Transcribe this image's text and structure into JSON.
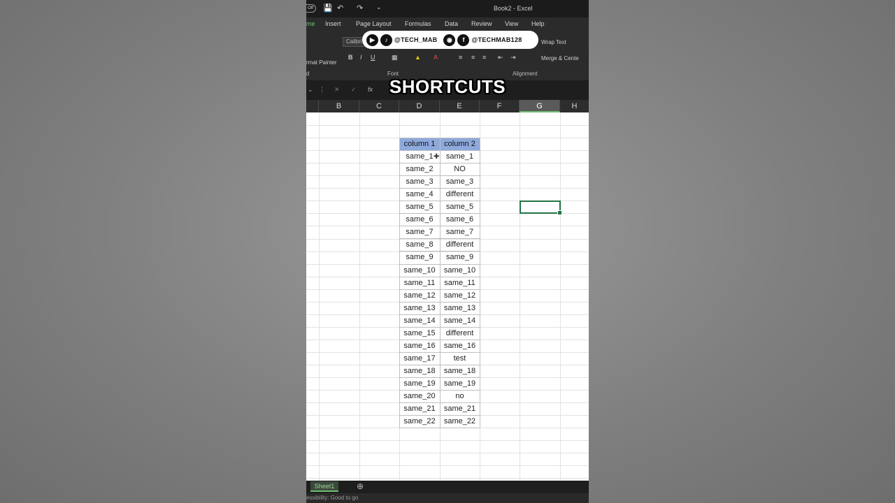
{
  "window": {
    "title": "Book2 - Excel",
    "autosave_label": "Off"
  },
  "ribbon": {
    "tabs": [
      {
        "label": "me",
        "active": true
      },
      {
        "label": "Insert"
      },
      {
        "label": "Page Layout"
      },
      {
        "label": "Formulas"
      },
      {
        "label": "Data"
      },
      {
        "label": "Review"
      },
      {
        "label": "View"
      },
      {
        "label": "Help"
      }
    ],
    "font_name": "Calibri",
    "format_painter": "rmat Painter",
    "wrap_text": "Wrap Text",
    "merge_center": "Merge & Cente",
    "group_labels": {
      "clipboard": "d",
      "font": "Font",
      "alignment": "Alignment"
    },
    "bold": "B",
    "italic": "I",
    "underline": "U"
  },
  "overlay": {
    "tiktok_handle": "@TECH_MAB",
    "facebook_handle": "@TECHMAB128",
    "headline": "SHORTCUTS"
  },
  "formula_bar": {
    "fx": "fx"
  },
  "columns": [
    "B",
    "C",
    "D",
    "E",
    "F",
    "G",
    "H"
  ],
  "selected_column": "G",
  "table": {
    "headers": [
      "column 1",
      "column 2"
    ],
    "rows": [
      [
        "same_1",
        "same_1"
      ],
      [
        "same_2",
        "NO"
      ],
      [
        "same_3",
        "same_3"
      ],
      [
        "same_4",
        "different"
      ],
      [
        "same_5",
        "same_5"
      ],
      [
        "same_6",
        "same_6"
      ],
      [
        "same_7",
        "same_7"
      ],
      [
        "same_8",
        "different"
      ],
      [
        "same_9",
        "same_9"
      ],
      [
        "same_10",
        "same_10"
      ],
      [
        "same_11",
        "same_11"
      ],
      [
        "same_12",
        "same_12"
      ],
      [
        "same_13",
        "same_13"
      ],
      [
        "same_14",
        "same_14"
      ],
      [
        "same_15",
        "different"
      ],
      [
        "same_16",
        "same_16"
      ],
      [
        "same_17",
        "test"
      ],
      [
        "same_18",
        "same_18"
      ],
      [
        "same_19",
        "same_19"
      ],
      [
        "same_20",
        "no"
      ],
      [
        "same_21",
        "same_21"
      ],
      [
        "same_22",
        "same_22"
      ]
    ]
  },
  "sheets": [
    {
      "label": "Sheet1",
      "active": true
    }
  ],
  "status": {
    "text": "essibility: Good to go"
  },
  "colors": {
    "accent": "#217346",
    "header_fill": "#8ea9db"
  }
}
